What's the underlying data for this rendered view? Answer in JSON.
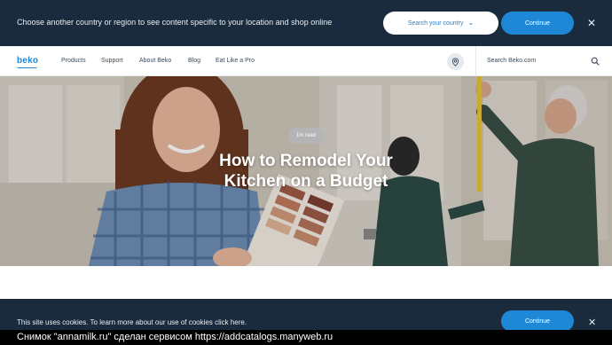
{
  "country_bar": {
    "message": "Choose another country or region to see content specific to your location and shop online",
    "search_label": "Search your country",
    "continue_label": "Continue",
    "close_glyph": "✕"
  },
  "nav": {
    "logo": "beko",
    "items": [
      {
        "label": "Products"
      },
      {
        "label": "Support"
      },
      {
        "label": "About Beko"
      },
      {
        "label": "Blog"
      },
      {
        "label": "Eat Like a Pro"
      }
    ],
    "location_icon": "location-pin-icon",
    "search_placeholder": "Search Beko.com",
    "search_icon": "search-icon"
  },
  "hero": {
    "read_time": "1m read",
    "title_line1": "How to Remodel Your",
    "title_line2": "Kitchen on a Budget"
  },
  "cookie_bar": {
    "message": "This site uses cookies. To learn more about our use of cookies click here.",
    "continue_label": "Continue",
    "close_glyph": "✕"
  },
  "watermark": "Снимок \"annamilk.ru\" сделан сервисом https://addcatalogs.manyweb.ru",
  "colors": {
    "dark_bar": "#1a2b3e",
    "accent": "#1e88d6",
    "nav_text": "#3b4a5a"
  }
}
